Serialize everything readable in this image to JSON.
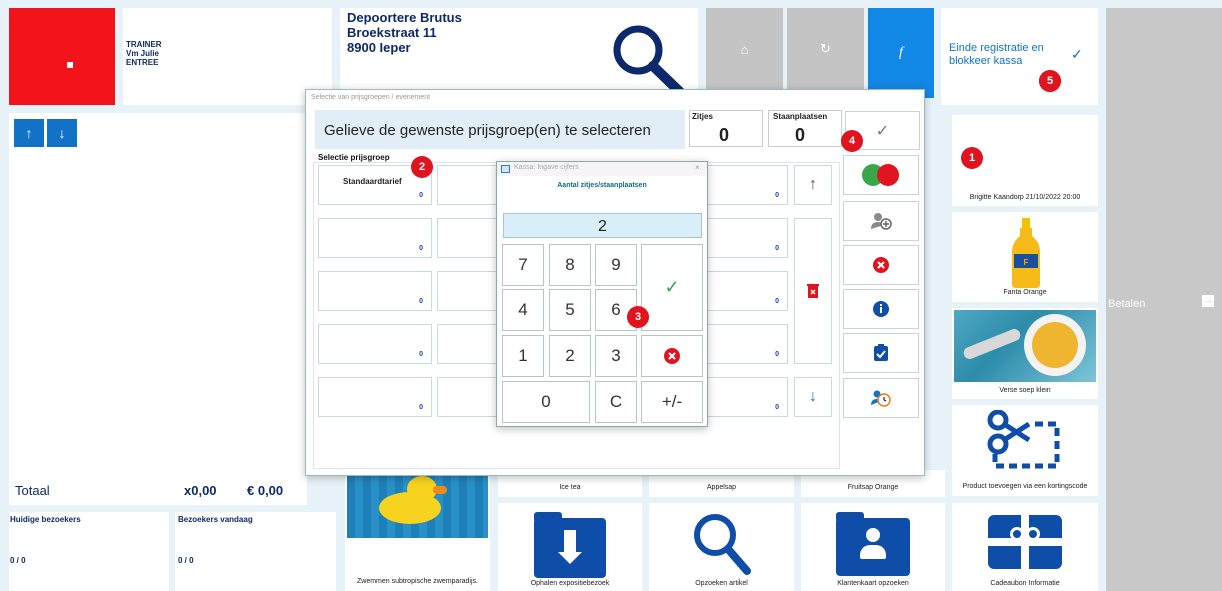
{
  "header": {
    "operator": [
      "TRAINER",
      "Vm Julie",
      "ENTREE"
    ],
    "customer": [
      "Depoortere  Brutus",
      "Broekstraat 11",
      "8900 Ieper"
    ],
    "fn_label": "f",
    "end_registration": "Einde registratie en blokkeer kassa"
  },
  "left_panel": {
    "total_label": "Totaal",
    "total_qty": "x0,00",
    "total_amount": "€ 0,00",
    "current_visitors_label": "Huidige bezoekers",
    "current_visitors_value": "0 / 0",
    "visitors_today_label": "Bezoekers vandaag",
    "visitors_today_value": "0 / 0"
  },
  "pay_label": "Betalen",
  "products": [
    {
      "label": "Brigitte Kaandorp 21/10/2022 20:00"
    },
    {
      "label": "Fanta Orange"
    },
    {
      "label": "Verse soep klein"
    },
    {
      "label": "Product toevoegen via een kortingscode"
    },
    {
      "label": "Zwemmen subtropische zwemparadijs."
    },
    {
      "label": "Ice tea"
    },
    {
      "label": "Appelsap"
    },
    {
      "label": "Fruitsap Orange"
    },
    {
      "label": "Ophalen expositiebezoek"
    },
    {
      "label": "Opzoeken artikel"
    },
    {
      "label": "Klantenkaart opzoeken"
    },
    {
      "label": "Cadeaubon Informatie"
    }
  ],
  "price_dialog": {
    "window_title": "Selectie van prijsgroepen / evenement",
    "instruction": "Gelieve de gewenste prijsgroep(en) te selecteren",
    "seats_label": "Zitjes",
    "seats_value": "0",
    "standing_label": "Staanplaatsen",
    "standing_value": "0",
    "group_header": "Selectie prijsgroep",
    "first_group": "Standaardtarief",
    "zero": "0"
  },
  "keypad": {
    "window_title": "Kassa: Ingave cijfers",
    "subtitle": "Aantal zitjes/staanplaatsen",
    "value": "2",
    "keys": [
      "7",
      "8",
      "9",
      "4",
      "5",
      "6",
      "1",
      "2",
      "3",
      "0",
      "C",
      "+/-"
    ]
  },
  "badges": [
    "1",
    "2",
    "3",
    "4",
    "5"
  ],
  "colors": {
    "red": "#f2131b",
    "blue": "#1273c6",
    "navy": "#0c2a6b",
    "grey": "#c4c4c4"
  }
}
